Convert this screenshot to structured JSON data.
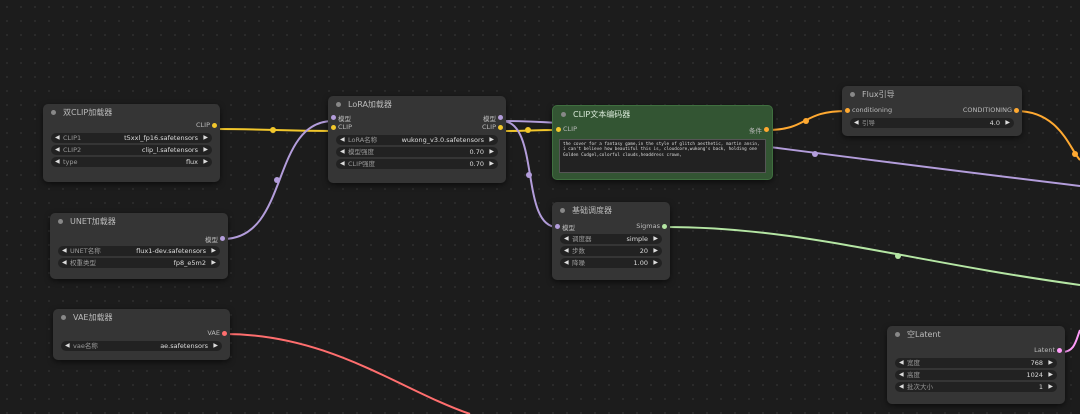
{
  "colors": {
    "clip": "#f2c72c",
    "model": "#b39ddb",
    "vae": "#ff6e6e",
    "conditioning": "#ffa931",
    "sigmas": "#b5e6a4",
    "latent": "#ff9cf9"
  },
  "dual_clip": {
    "title": "双CLIP加载器",
    "out": "CLIP",
    "w": [
      {
        "label": "CLIP1",
        "value": "t5xxl_fp16.safetensors"
      },
      {
        "label": "CLIP2",
        "value": "clip_l.safetensors"
      },
      {
        "label": "type",
        "value": "flux"
      }
    ]
  },
  "unet": {
    "title": "UNET加载器",
    "out": "模型",
    "w": [
      {
        "label": "UNET名称",
        "value": "flux1-dev.safetensors"
      },
      {
        "label": "权重类型",
        "value": "fp8_e5m2"
      }
    ]
  },
  "vae": {
    "title": "VAE加载器",
    "out": "VAE",
    "w": [
      {
        "label": "vae名称",
        "value": "ae.safetensors"
      }
    ]
  },
  "lora": {
    "title": "LoRA加载器",
    "in1": "模型",
    "in2": "CLIP",
    "out1": "模型",
    "out2": "CLIP",
    "w": [
      {
        "label": "LoRA名称",
        "value": "wukong_v3.0.safetensors"
      },
      {
        "label": "模型强度",
        "value": "0.70"
      },
      {
        "label": "CLIP强度",
        "value": "0.70"
      }
    ]
  },
  "clip_text": {
    "title": "CLIP文本编码器",
    "in": "CLIP",
    "out": "条件",
    "text": "the cover for a fantasy game,in the style of glitch aesthetic, martin ansin, i can't believe how beautiful this is, cloudcore,wukong's back, holding one Golden Cudgel,colorful clouds,headdress crown,"
  },
  "scheduler": {
    "title": "基础调度器",
    "in": "模型",
    "out": "Sigmas",
    "w": [
      {
        "label": "调度器",
        "value": "simple"
      },
      {
        "label": "步数",
        "value": "20"
      },
      {
        "label": "降噪",
        "value": "1.00"
      }
    ]
  },
  "flux_guide": {
    "title": "Flux引导",
    "in": "conditioning",
    "out": "CONDITIONING",
    "w": [
      {
        "label": "引导",
        "value": "4.0"
      }
    ]
  },
  "latent": {
    "title": "空Latent",
    "out": "Latent",
    "w": [
      {
        "label": "宽度",
        "value": "768"
      },
      {
        "label": "高度",
        "value": "1024"
      },
      {
        "label": "批次大小",
        "value": "1"
      }
    ]
  }
}
